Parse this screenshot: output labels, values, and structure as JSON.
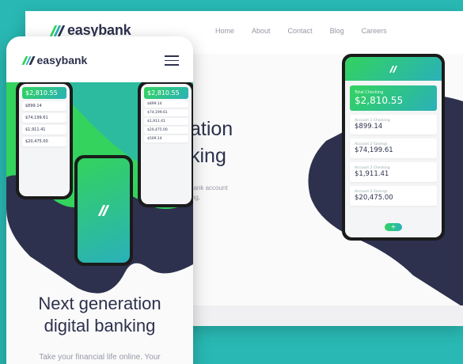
{
  "brand": {
    "name": "easybank",
    "colors": {
      "green": "#33d35e",
      "cyan": "#2ab1b9",
      "navy": "#2d314d",
      "bg": "#29b8b3"
    }
  },
  "desktop": {
    "nav": [
      "Home",
      "About",
      "Contact",
      "Blog",
      "Careers"
    ],
    "title_line1": "ation",
    "title_line2": "king",
    "sub_line1": "bank account",
    "sub_line2": "ing,"
  },
  "phone_desktop": {
    "total_label": "Total Checking",
    "total_amount": "$2,810.55",
    "accounts": [
      {
        "label": "Account 1 Checking",
        "amount": "$899.14"
      },
      {
        "label": "Account 2 Savings",
        "amount": "$74,199.61"
      },
      {
        "label": "Account 2 Checking",
        "amount": "$1,911.41"
      },
      {
        "label": "Account 3 Savings",
        "amount": "$20,475.00"
      }
    ],
    "add_icon": "plus-icon"
  },
  "mobile": {
    "brand": "easybank",
    "title_line1": "Next generation",
    "title_line2": "digital banking",
    "sub": "Take your financial life online. Your",
    "hero_left": {
      "total_amount": "$2,810.55",
      "accounts": [
        "$899.14",
        "$74,199.61",
        "$1,911.41",
        "$20,475.00"
      ]
    },
    "hero_right": {
      "total_amount": "$2,810.55",
      "accounts": [
        "$899.14",
        "$74,199.61",
        "$1,911.41",
        "$20,475.00",
        "$509.14"
      ]
    }
  }
}
